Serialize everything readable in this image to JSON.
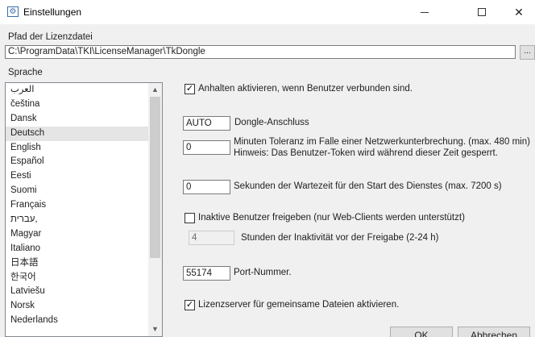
{
  "window": {
    "title": "Einstellungen",
    "icon": "settings-app-icon",
    "minimize_icon": "minimize-icon",
    "maximize_icon": "maximize-icon",
    "close_icon": "close-icon"
  },
  "license_path": {
    "label": "Pfad der Lizenzdatei",
    "value": "C:\\ProgramData\\TKI\\LicenseManager\\TkDongle",
    "browse_label": "..."
  },
  "language": {
    "label": "Sprache",
    "selected": "Deutsch",
    "items": [
      "العرب",
      "čeština",
      "Dansk",
      "Deutsch",
      "English",
      "Español",
      "Eesti",
      "Suomi",
      "Français",
      "עברית,",
      "Magyar",
      "Italiano",
      "日本語",
      "한국어",
      "Latviešu",
      "Norsk",
      "Nederlands"
    ]
  },
  "options": {
    "stop_when_users_connected": {
      "checked": true,
      "label": "Anhalten aktivieren, wenn Benutzer verbunden sind."
    },
    "dongle_port": {
      "value": "AUTO",
      "label": "Dongle-Anschluss"
    },
    "tolerance": {
      "value": "0",
      "label": "Minuten Toleranz im Falle einer Netzwerkunterbrechung. (max. 480 min)",
      "hint": "Hinweis: Das Benutzer-Token wird während dieser Zeit gesperrt."
    },
    "service_wait": {
      "value": "0",
      "label": "Sekunden der Wartezeit für den Start des Dienstes (max. 7200 s)"
    },
    "release_inactive": {
      "checked": false,
      "label": "Inaktive Benutzer freigeben (nur Web-Clients werden unterstützt)"
    },
    "inactivity_hours": {
      "value": "4",
      "label": "Stunden der Inaktivität vor der Freigabe (2-24 h)"
    },
    "port": {
      "value": "55174",
      "label": "Port-Nummer."
    },
    "shared_files_server": {
      "checked": true,
      "label": "Lizenzserver für gemeinsame Dateien aktivieren."
    }
  },
  "buttons": {
    "ok": "OK",
    "cancel": "Abbrechen"
  }
}
